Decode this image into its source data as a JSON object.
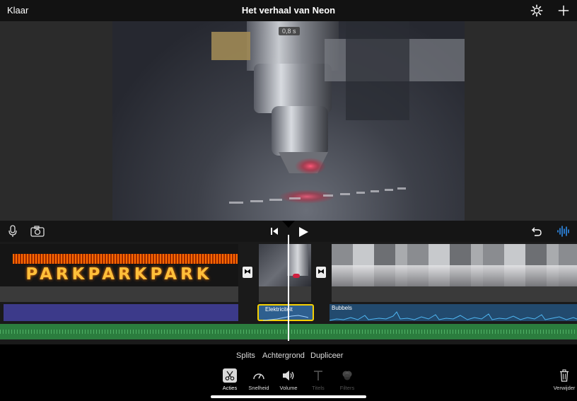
{
  "header": {
    "done_label": "Klaar",
    "project_title": "Het verhaal van Neon",
    "settings_icon": "gear-icon",
    "add_icon": "plus-icon"
  },
  "viewer": {
    "clip_duration_badge": "0,8 s"
  },
  "toolbar": {
    "mic_icon": "microphone-icon",
    "camera_icon": "camera-icon",
    "rewind_icon": "skip-to-start-icon",
    "play_icon": "play-icon",
    "undo_icon": "undo-icon",
    "audio_wave_icon": "audio-waveform-icon"
  },
  "timeline": {
    "clip1_sign_text": "PARKPARKPARK",
    "audio_clips": [
      {
        "name": "Elektriciteit",
        "selected": true
      },
      {
        "name": "Bubbels",
        "selected": false
      }
    ]
  },
  "actions": {
    "items": [
      "Splits",
      "Achtergrond",
      "Dupliceer"
    ]
  },
  "tools": [
    {
      "label": "Acties",
      "icon": "scissors-icon",
      "selected": true,
      "enabled": true
    },
    {
      "label": "Snelheid",
      "icon": "speedometer-icon",
      "selected": false,
      "enabled": true
    },
    {
      "label": "Volume",
      "icon": "speaker-icon",
      "selected": false,
      "enabled": true
    },
    {
      "label": "Titels",
      "icon": "title-icon",
      "selected": false,
      "enabled": false
    },
    {
      "label": "Filters",
      "icon": "filters-icon",
      "selected": false,
      "enabled": false
    }
  ],
  "delete": {
    "label": "Verwijder",
    "icon": "trash-icon"
  },
  "colors": {
    "accent_yellow": "#f5d000",
    "audio_blue": "#3a7fb8",
    "background_track": "#2b7d3e",
    "purple_track": "#3c3a8a"
  }
}
